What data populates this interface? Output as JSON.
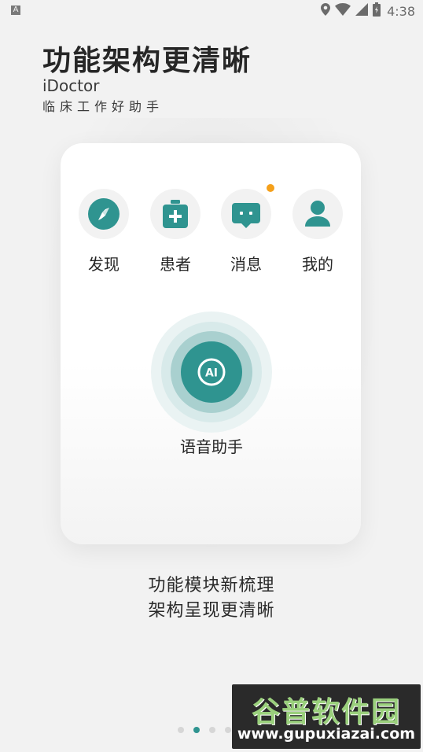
{
  "status_bar": {
    "left_icon": "A",
    "time": "4:38",
    "icons": [
      "location-icon",
      "wifi-icon",
      "signal-icon",
      "battery-icon"
    ]
  },
  "header": {
    "title": "功能架构更清晰",
    "subtitle_en": "iDoctor",
    "subtitle_cn": "临床工作好助手"
  },
  "card": {
    "nav_items": [
      {
        "label": "发现",
        "icon": "compass-icon"
      },
      {
        "label": "患者",
        "icon": "medical-kit-icon"
      },
      {
        "label": "消息",
        "icon": "message-icon",
        "badge": true
      },
      {
        "label": "我的",
        "icon": "user-icon"
      }
    ],
    "voice_assistant": {
      "icon_text": "AI",
      "label": "语音助手"
    }
  },
  "description": {
    "line1": "功能模块新梳理",
    "line2": "架构呈现更清晰"
  },
  "pager": {
    "total": 4,
    "active_index": 1
  },
  "watermark": {
    "title": "谷普软件园",
    "url": "www.gupuxiazai.com"
  },
  "colors": {
    "accent": "#2f9490",
    "badge": "#f5a01a",
    "background": "#f2f2f2"
  }
}
